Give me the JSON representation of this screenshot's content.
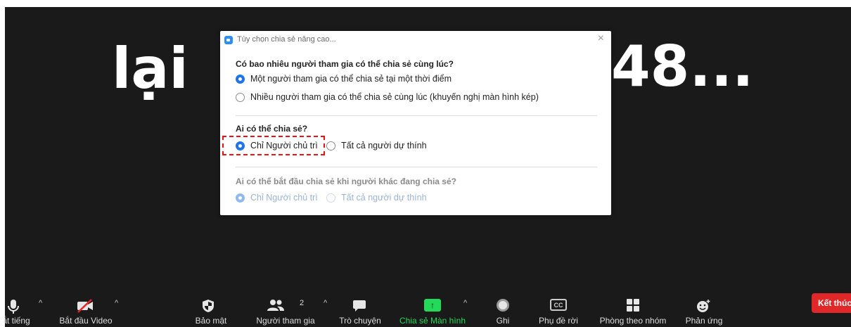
{
  "background": {
    "left_text": "lại",
    "right_text": "48..."
  },
  "dialog": {
    "title": "Tùy chọn chia sẻ nâng cao...",
    "close_glyph": "×",
    "q1": "Có bao nhiêu người tham gia có thể chia sẻ cùng lúc?",
    "q1_options": [
      "Một người tham gia có thể chia sẻ tại một thời điểm",
      "Nhiều người tham gia có thể chia sẻ cùng lúc (khuyến nghị màn hình kép)"
    ],
    "q1_selected": 0,
    "q2": "Ai có thể chia sẻ?",
    "q2_options": [
      "Chỉ Người chủ trì",
      "Tất cả người dự thính"
    ],
    "q2_selected": 0,
    "q3": "Ai có thể bắt đầu chia sẻ khi người khác đang chia sẻ?",
    "q3_options": [
      "Chỉ Người chủ trì",
      "Tất cả người dự thính"
    ],
    "q3_selected": 0,
    "q3_disabled": true
  },
  "toolbar": {
    "mute_label": "ắt tiếng",
    "video_label": "Bắt đầu Video",
    "security_label": "Bảo mật",
    "participants_label": "Người tham gia",
    "participants_count": "2",
    "chat_label": "Trò chuyện",
    "share_label": "Chia sẻ Màn hình",
    "record_label": "Ghi",
    "captions_label": "Phụ đề rời",
    "captions_icon_text": "CC",
    "breakout_label": "Phòng theo nhóm",
    "reactions_label": "Phản ứng",
    "end_label": "Kết thúc",
    "caret": "^"
  },
  "colors": {
    "accent": "#1f75e8",
    "share_green": "#23d959",
    "end_red": "#e02828",
    "stage_bg": "#1a1a1a"
  }
}
